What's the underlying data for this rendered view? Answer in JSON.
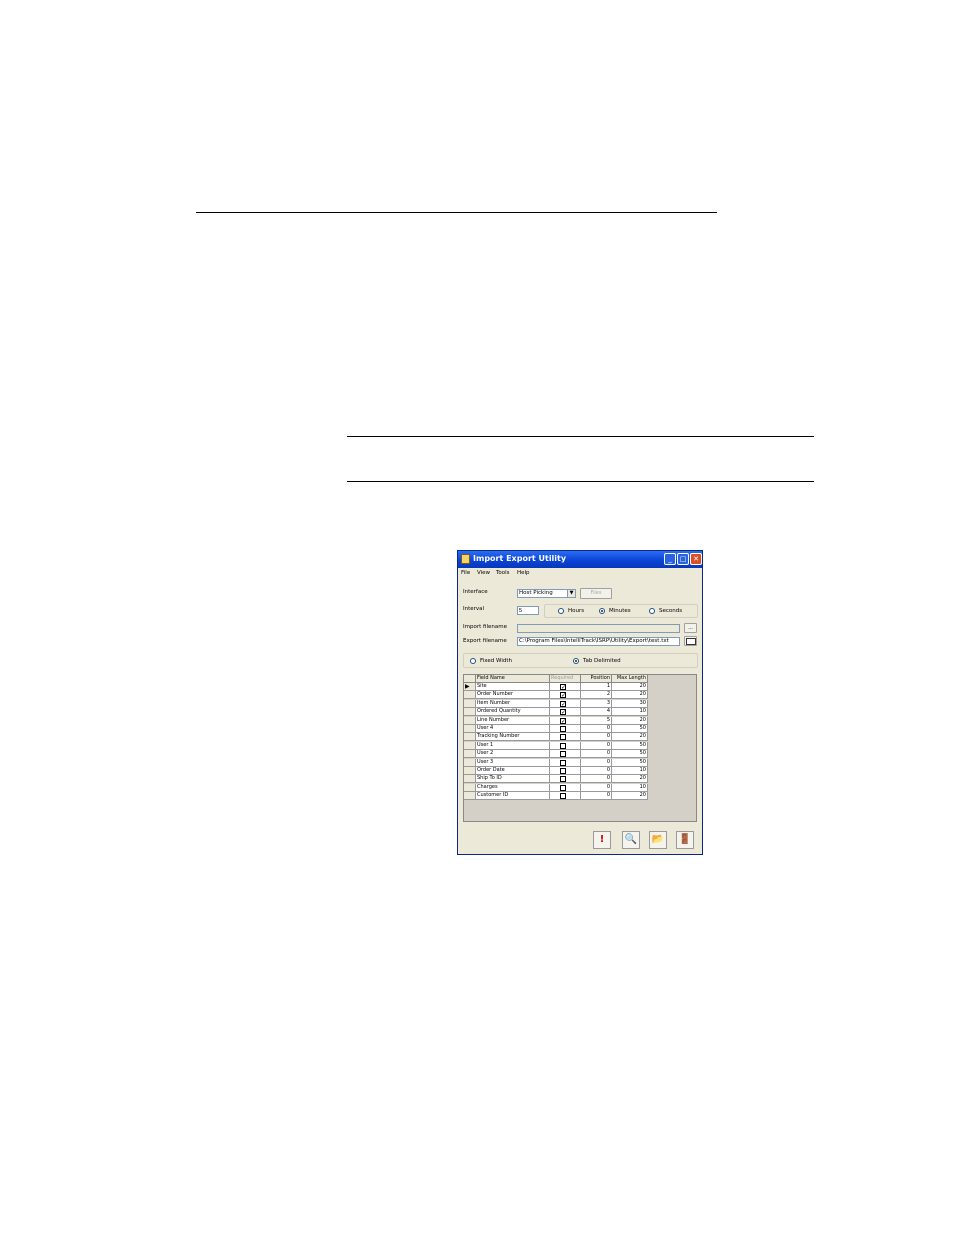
{
  "window": {
    "title": "Import Export Utility",
    "controls": {
      "minimize": "_",
      "maximize": "□",
      "close": "✕"
    }
  },
  "menu": [
    "File",
    "View",
    "Tools",
    "Help"
  ],
  "form": {
    "interface_label": "Interface",
    "interface_value": "Host Picking",
    "files_button": "Files",
    "interval_label": "Interval",
    "interval_value": "5",
    "interval_units": [
      {
        "label": "Hours",
        "selected": false
      },
      {
        "label": "Minutes",
        "selected": true
      },
      {
        "label": "Seconds",
        "selected": false
      }
    ],
    "import_label": "Import filename",
    "import_value": "",
    "browse_button": "...",
    "export_label": "Export filename",
    "export_value": "C:\\Program Files\\IntelliTrack\\ISRP\\Utility\\Export\\test.txt",
    "format_options": [
      {
        "label": "Fixed Width",
        "selected": false
      },
      {
        "label": "Tab Delimited",
        "selected": true
      }
    ]
  },
  "grid": {
    "columns": [
      "Field Name",
      "Required",
      "Position",
      "Max Length"
    ],
    "rows": [
      {
        "field": "Site",
        "required": true,
        "position": "1",
        "max_length": "20"
      },
      {
        "field": "Order Number",
        "required": true,
        "position": "2",
        "max_length": "20"
      },
      {
        "field": "Item Number",
        "required": true,
        "position": "3",
        "max_length": "30"
      },
      {
        "field": "Ordered Quantity",
        "required": true,
        "position": "4",
        "max_length": "10"
      },
      {
        "field": "Line Number",
        "required": true,
        "position": "5",
        "max_length": "20"
      },
      {
        "field": "User 4",
        "required": false,
        "position": "0",
        "max_length": "50"
      },
      {
        "field": "Tracking Number",
        "required": false,
        "position": "0",
        "max_length": "20"
      },
      {
        "field": "User 1",
        "required": false,
        "position": "0",
        "max_length": "50"
      },
      {
        "field": "User 2",
        "required": false,
        "position": "0",
        "max_length": "50"
      },
      {
        "field": "User 3",
        "required": false,
        "position": "0",
        "max_length": "50"
      },
      {
        "field": "Order Date",
        "required": false,
        "position": "0",
        "max_length": "10"
      },
      {
        "field": "Ship To ID",
        "required": false,
        "position": "0",
        "max_length": "20"
      },
      {
        "field": "Charges",
        "required": false,
        "position": "0",
        "max_length": "10"
      },
      {
        "field": "Customer ID",
        "required": false,
        "position": "0",
        "max_length": "20"
      }
    ]
  },
  "toolbar": [
    {
      "name": "run-button",
      "icon": "exclamation-icon",
      "glyph": "!",
      "color": "#cc0000"
    },
    {
      "name": "preview-button",
      "icon": "magnifier-icon",
      "glyph": "🔍",
      "color": "#333333"
    },
    {
      "name": "open-button",
      "icon": "folder-icon",
      "glyph": "📂",
      "color": "#c8a000"
    },
    {
      "name": "exit-button",
      "icon": "exit-door-icon",
      "glyph": "🚪",
      "color": "#2a6a2a"
    }
  ],
  "colors": {
    "titlebar": "#0a45d8",
    "window_bg": "#ece9d8",
    "close_button": "#d8502a"
  }
}
